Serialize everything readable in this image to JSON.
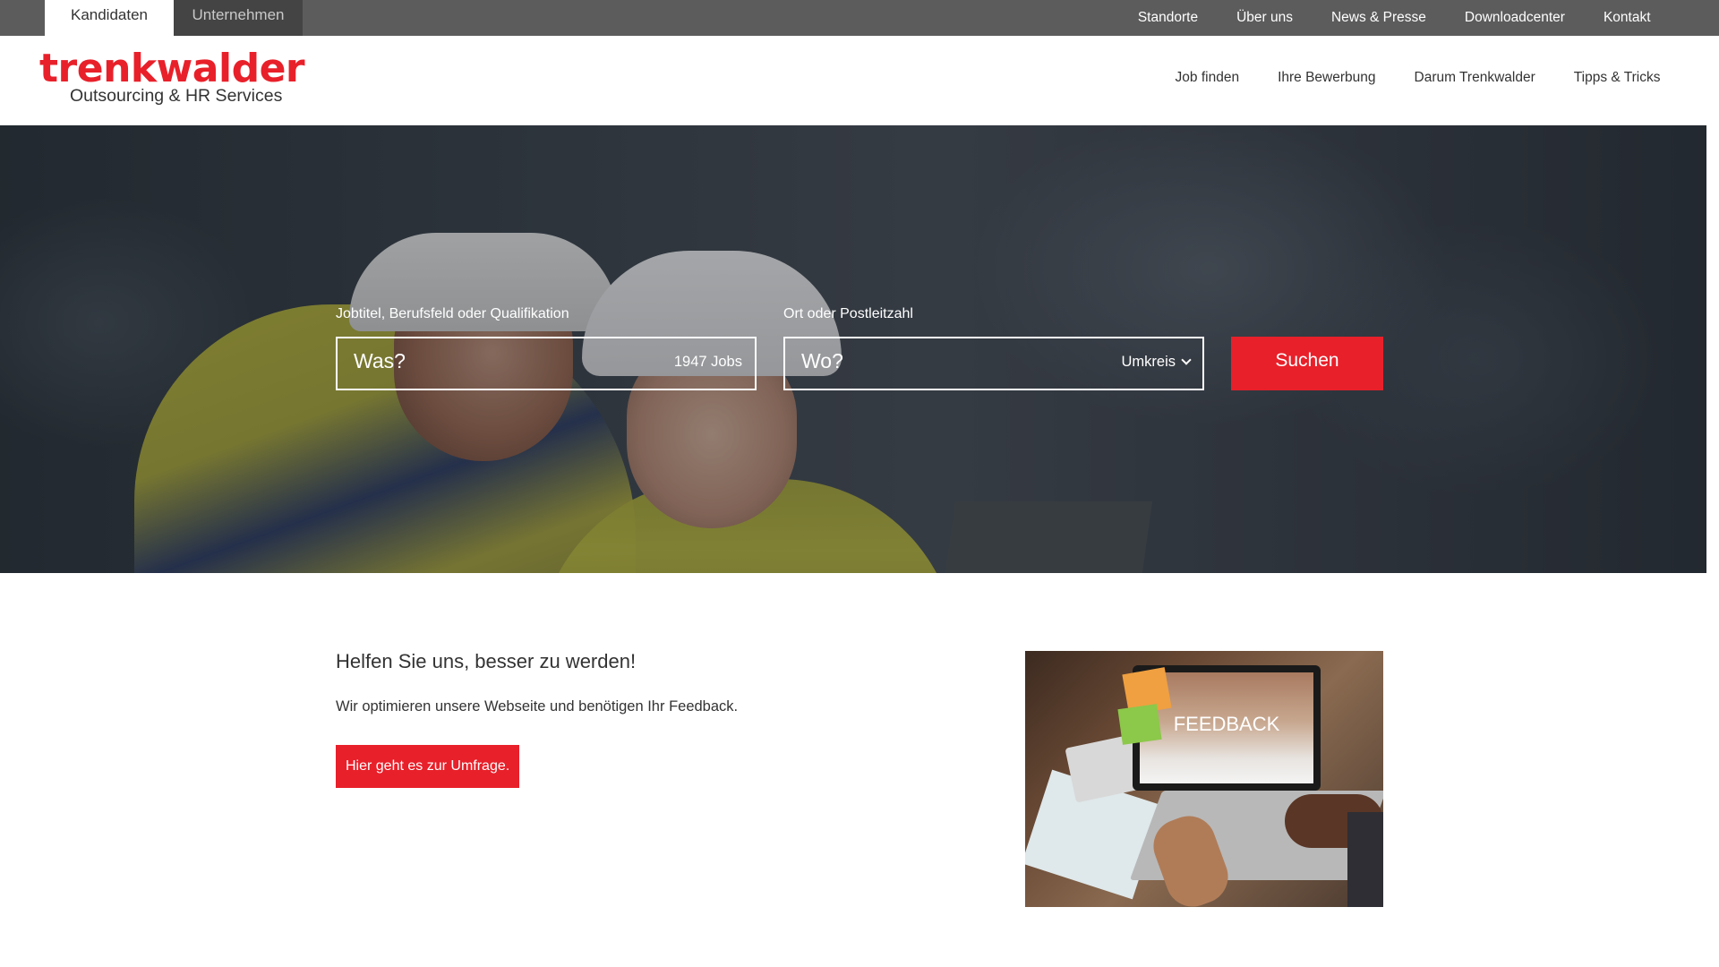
{
  "topbar": {
    "tabs": [
      {
        "label": "Kandidaten",
        "active": true
      },
      {
        "label": "Unternehmen",
        "active": false
      }
    ],
    "links": [
      "Standorte",
      "Über uns",
      "News & Presse",
      "Downloadcenter",
      "Kontakt"
    ]
  },
  "header": {
    "logo_main": "trenkwalder",
    "logo_sub": "Outsourcing & HR Services",
    "nav": [
      "Job finden",
      "Ihre Bewerbung",
      "Darum Trenkwalder",
      "Tipps & Tricks"
    ]
  },
  "search": {
    "what_label": "Jobtitel, Berufsfeld oder Qualifikation",
    "what_placeholder": "Was?",
    "job_count": "1947 Jobs",
    "where_label": "Ort oder Postleitzahl",
    "where_placeholder": "Wo?",
    "radius_label": "Umkreis",
    "submit_label": "Suchen"
  },
  "feedback": {
    "title": "Helfen Sie uns, besser zu werden!",
    "text": "Wir optimieren unsere Webseite und benötigen Ihr Feedback.",
    "button_label": "Hier geht es zur Umfrage.",
    "image_text": "FEEDBACK"
  },
  "colors": {
    "brand_red": "#e8202a",
    "topbar_bg": "#5c5c5c",
    "tab_inactive_bg": "#444444"
  },
  "icons": {
    "radius_dropdown": "chevron-down-icon"
  }
}
